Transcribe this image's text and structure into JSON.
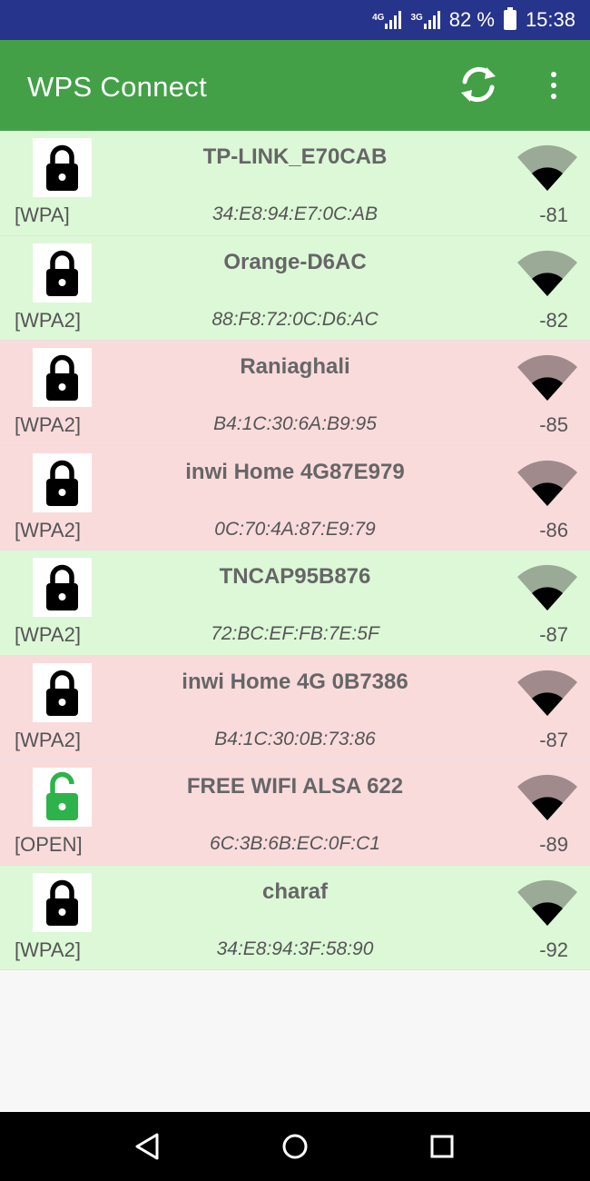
{
  "status_bar": {
    "network1": "4G",
    "network2": "3G",
    "battery": "82 %",
    "time": "15:38"
  },
  "app_bar": {
    "title": "WPS Connect",
    "refresh_icon": "refresh-icon",
    "menu_icon": "more-vert-icon"
  },
  "colors": {
    "status_bar": "#27348b",
    "app_bar": "#43a047",
    "row_green": "#dcf8d7",
    "row_red": "#f9dbdc",
    "open_lock": "#2db34a"
  },
  "networks": [
    {
      "ssid": "TP-LINK_E70CAB",
      "bssid": "34:E8:94:E7:0C:AB",
      "security": "[WPA]",
      "level": "-81",
      "status": "green",
      "locked": true,
      "signal_bars": 1
    },
    {
      "ssid": "Orange-D6AC",
      "bssid": "88:F8:72:0C:D6:AC",
      "security": "[WPA2]",
      "level": "-82",
      "status": "green",
      "locked": true,
      "signal_bars": 1
    },
    {
      "ssid": "Raniaghali",
      "bssid": "B4:1C:30:6A:B9:95",
      "security": "[WPA2]",
      "level": "-85",
      "status": "red",
      "locked": true,
      "signal_bars": 1
    },
    {
      "ssid": "inwi Home 4G87E979",
      "bssid": "0C:70:4A:87:E9:79",
      "security": "[WPA2]",
      "level": "-86",
      "status": "red",
      "locked": true,
      "signal_bars": 1
    },
    {
      "ssid": "TNCAP95B876",
      "bssid": "72:BC:EF:FB:7E:5F",
      "security": "[WPA2]",
      "level": "-87",
      "status": "green",
      "locked": true,
      "signal_bars": 1
    },
    {
      "ssid": "inwi Home 4G 0B7386",
      "bssid": "B4:1C:30:0B:73:86",
      "security": "[WPA2]",
      "level": "-87",
      "status": "red",
      "locked": true,
      "signal_bars": 1
    },
    {
      "ssid": "FREE WIFI ALSA 622",
      "bssid": "6C:3B:6B:EC:0F:C1",
      "security": "[OPEN]",
      "level": "-89",
      "status": "red",
      "locked": false,
      "signal_bars": 1
    },
    {
      "ssid": "charaf",
      "bssid": "34:E8:94:3F:58:90",
      "security": "[WPA2]",
      "level": "-92",
      "status": "green",
      "locked": true,
      "signal_bars": 1
    }
  ],
  "nav_bar": {
    "back_icon": "back-icon",
    "home_icon": "home-icon",
    "recents_icon": "recents-icon"
  }
}
